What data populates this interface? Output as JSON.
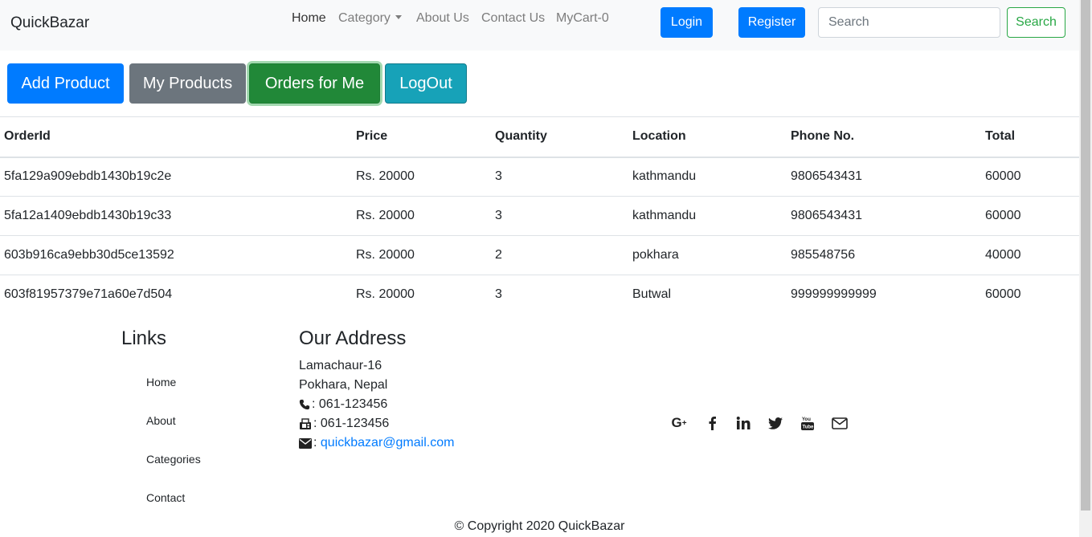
{
  "navbar": {
    "brand": "QuickBazar",
    "links": [
      "Home",
      "Category",
      "About Us",
      "Contact Us",
      "MyCart-0"
    ],
    "login_label": "Login",
    "register_label": "Register",
    "search_placeholder": "Search",
    "search_button": "Search"
  },
  "actions": {
    "add_product": "Add Product",
    "my_products": "My Products",
    "orders_for_me": "Orders for Me",
    "logout": "LogOut"
  },
  "table": {
    "headers": [
      "OrderId",
      "Price",
      "Quantity",
      "Location",
      "Phone No.",
      "Total"
    ],
    "rows": [
      [
        "5fa129a909ebdb1430b19c2e",
        "Rs. 20000",
        "3",
        "kathmandu",
        "9806543431",
        "60000"
      ],
      [
        "5fa12a1409ebdb1430b19c33",
        "Rs. 20000",
        "3",
        "kathmandu",
        "9806543431",
        "60000"
      ],
      [
        "603b916ca9ebb30d5ce13592",
        "Rs. 20000",
        "2",
        "pokhara",
        "985548756",
        "40000"
      ],
      [
        "603f81957379e71a60e7d504",
        "Rs. 20000",
        "3",
        "Butwal",
        "999999999999",
        "60000"
      ]
    ]
  },
  "footer": {
    "links_heading": "Links",
    "links": [
      "Home",
      "About",
      "Categories",
      "Contact"
    ],
    "address_heading": "Our Address",
    "address_line1": "Lamachaur-16",
    "address_line2": "Pokhara, Nepal",
    "phone": ": 061-123456",
    "fax": ": 061-123456",
    "email_prefix": ":",
    "email": "quickbazar@gmail.com",
    "social_icons": [
      "google-plus-icon",
      "facebook-icon",
      "linkedin-icon",
      "twitter-icon",
      "youtube-icon",
      "envelope-icon"
    ],
    "copyright": "© Copyright 2020 QuickBazar"
  }
}
